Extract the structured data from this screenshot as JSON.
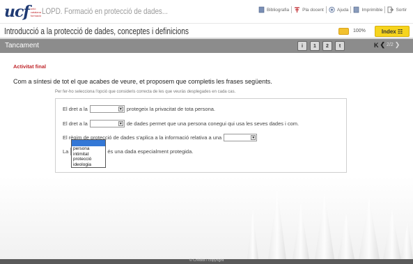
{
  "header": {
    "logo_text": "ucf",
    "logo_sub": [
      "unió",
      "catalana",
      "formació"
    ],
    "app_title": "LOPD. Formació en protecció de dades...",
    "links": [
      {
        "label": "Bibliografia",
        "icon": "book-icon"
      },
      {
        "label": "Pla docent",
        "icon": "plan-icon"
      },
      {
        "label": "Ajuda",
        "icon": "help-icon"
      },
      {
        "label": "Imprimible",
        "icon": "print-icon"
      },
      {
        "label": "Sortir",
        "icon": "exit-icon"
      }
    ]
  },
  "course": {
    "title": "Introducció a la protecció de dades, conceptes i definicions",
    "zoom": "100%",
    "index_label": "Index ☷"
  },
  "section": {
    "title": "Tancament",
    "nav_buttons": [
      "i",
      "1",
      "2",
      "t"
    ],
    "pager_first": "K",
    "pager_prev": "❮",
    "page_counter": "2/2",
    "pager_next": "❯"
  },
  "activity": {
    "heading": "Activitat final",
    "question": "Com a síntesi de tot el que acabes de veure, et proposem que completis les frases següents.",
    "instruction": "Per fer-ho selecciona l'opció que consideris correcta de les que veuràs desplegades en cada cas.",
    "sentences": [
      {
        "before": "El dret a la",
        "after": "protegeix la privacitat de tota persona."
      },
      {
        "before": "El dret a la",
        "after": "de dades permet que una persona conegui qui usa les seves dades i com."
      },
      {
        "before": "El règim de protecció de dades s'aplica a la informació relativa a una",
        "after": ""
      },
      {
        "before": "La",
        "after": "és una dada especialment protegida."
      }
    ],
    "dropdown_options": [
      "persona",
      "intimitat",
      "protecció",
      "ideologia"
    ]
  },
  "footer": {
    "copyright": "© Crèdits i copyright"
  },
  "colors": {
    "accent_red": "#c0282d",
    "index_yellow": "#f6d41d",
    "section_gray": "#8c8c8c",
    "dropdown_highlight": "#3478d6"
  }
}
